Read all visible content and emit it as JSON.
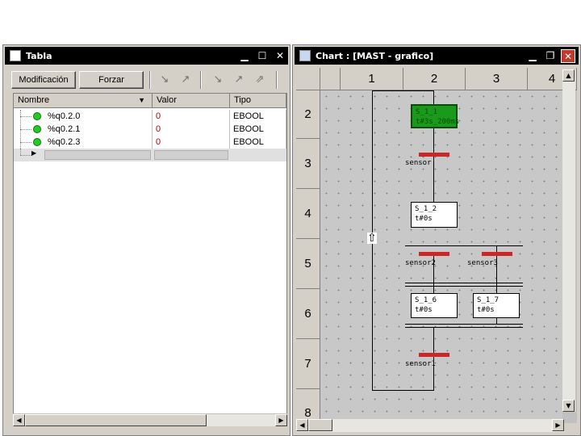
{
  "tabla": {
    "title": "Tabla",
    "buttons": {
      "modificacion": "Modificación",
      "forzar": "Forzar"
    },
    "columns": [
      "Nombre",
      "Valor",
      "Tipo"
    ],
    "rows": [
      {
        "nombre": "%q0.2.0",
        "valor": "0",
        "tipo": "EBOOL"
      },
      {
        "nombre": "%q0.2.1",
        "valor": "0",
        "tipo": "EBOOL"
      },
      {
        "nombre": "%q0.2.3",
        "valor": "0",
        "tipo": "EBOOL"
      }
    ],
    "led_color": "#22cc22",
    "value_color": "#b00000"
  },
  "chart": {
    "title": "Chart : [MAST - grafico]",
    "columns": [
      "1",
      "2",
      "3",
      "4"
    ],
    "rows": [
      "2",
      "3",
      "4",
      "5",
      "6",
      "7",
      "8"
    ],
    "steps": {
      "s1": {
        "name": "S_1_1",
        "time": "t#3s_200ms"
      },
      "s2": {
        "name": "S_1_2",
        "time": "t#0s"
      },
      "s6": {
        "name": "S_1_6",
        "time": "t#0s"
      },
      "s7": {
        "name": "S_1_7",
        "time": "t#0s"
      }
    },
    "transitions": {
      "t1": "sensor",
      "t2": "sensor2",
      "t3": "sensor3",
      "t4": "sensor1"
    },
    "active_step_color": "#1a9a1a",
    "transition_color": "#c82828"
  }
}
